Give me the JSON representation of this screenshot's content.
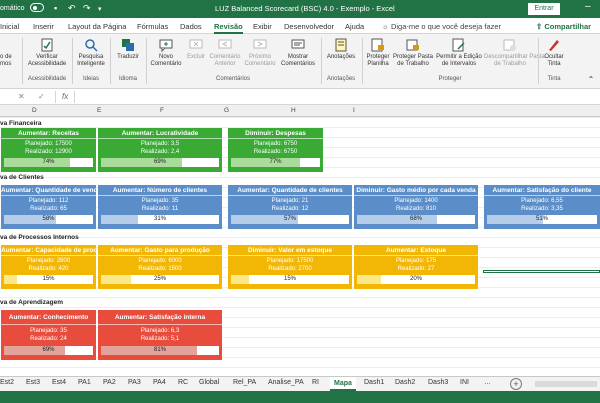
{
  "titlebar": {
    "autosave": "omático",
    "title": "LUZ Balanced Scorecard (BSC) 4.0 - Exemplo  -  Excel",
    "signin": "Entrar"
  },
  "tabs": [
    "Inicial",
    "Inserir",
    "Layout da Página",
    "Fórmulas",
    "Dados",
    "Revisão",
    "Exibir",
    "Desenvolvedor",
    "Ajuda"
  ],
  "tellme": "Diga-me o que você deseja fazer",
  "share": "Compartilhar",
  "ribbon": {
    "buttons": [
      {
        "label": "Verificar\nAcessibilidade",
        "icon": "check-icon",
        "disabled": false
      },
      {
        "label": "Pesquisa\nInteligente",
        "icon": "search-icon",
        "disabled": false
      },
      {
        "label": "Traduzir",
        "icon": "translate-icon",
        "disabled": false
      },
      {
        "label": "Novo\nComentário",
        "icon": "new-comment-icon",
        "disabled": false
      },
      {
        "label": "Excluir",
        "icon": "delete-comment-icon",
        "disabled": true
      },
      {
        "label": "Comentário\nAnterior",
        "icon": "previous-comment-icon",
        "disabled": true
      },
      {
        "label": "Próximo\nComentário",
        "icon": "next-comment-icon",
        "disabled": true
      },
      {
        "label": "Mostrar\nComentários",
        "icon": "show-comments-icon",
        "disabled": false
      },
      {
        "label": "Anotações",
        "icon": "notes-icon",
        "disabled": false
      },
      {
        "label": "Proteger\nPlanilha",
        "icon": "protect-sheet-icon",
        "disabled": false
      },
      {
        "label": "Proteger Pasta\nde Trabalho",
        "icon": "protect-workbook-icon",
        "disabled": false
      },
      {
        "label": "Permitir a Edição\nde Intervalos",
        "icon": "allow-edit-icon",
        "disabled": false
      },
      {
        "label": "Descompartilhar Pasta\nde Trabalho",
        "icon": "unshare-icon",
        "disabled": true
      },
      {
        "label": "Ocultar\nTinta",
        "icon": "ink-icon",
        "disabled": false
      }
    ],
    "groups": [
      "Acessibilidade",
      "Ideias",
      "Idioma",
      "Comentários",
      "Anotações",
      "Proteger",
      "Tinta"
    ],
    "partial_left": "o de\nmos"
  },
  "columns": [
    "D",
    "E",
    "F",
    "G",
    "H",
    "I"
  ],
  "sections": {
    "financeira": "va Financeira",
    "clientes": "va de Clientes",
    "processos": "va de Processos Internos",
    "aprendizagem": "va de Aprendizagem"
  },
  "cards": {
    "fin": [
      {
        "title": "Aumentar: Receitas",
        "planned": "Planejado: 17500",
        "actual": "Realizado: 12900",
        "pct": "74%",
        "progress": 0.74
      },
      {
        "title": "Aumentar: Lucratividade",
        "planned": "Planejado: 3,5",
        "actual": "Realizado: 2,4",
        "pct": "69%",
        "progress": 0.69
      },
      {
        "title": "Diminuir: Despesas",
        "planned": "Planejado: 6750",
        "actual": "Realizado: 6750",
        "pct": "77%",
        "progress": 0.77
      }
    ],
    "cli": [
      {
        "title": "Aumentar: Quantidade de vendas",
        "planned": "Planejado: 112",
        "actual": "Realizado: 65",
        "pct": "58%",
        "progress": 0.58
      },
      {
        "title": "Aumentar: Número de clientes",
        "planned": "Planejado: 35",
        "actual": "Realizado: 11",
        "pct": "31%",
        "progress": 0.31
      },
      {
        "title": "Aumentar: Quantidade de clientes",
        "planned": "Planejado: 21",
        "actual": "Realizado: 12",
        "pct": "57%",
        "progress": 0.57
      },
      {
        "title": "Diminuir: Gasto médio por cada venda",
        "planned": "Planejado: 1400",
        "actual": "Realizado: 810",
        "pct": "68%",
        "progress": 0.68
      },
      {
        "title": "Aumentar: Satisfação do cliente",
        "planned": "Planejado: 6,55",
        "actual": "Realizado: 3,35",
        "pct": "51%",
        "progress": 0.51
      }
    ],
    "proc": [
      {
        "title": "Aumentar: Capacidade de produção",
        "planned": "Planejado: 2800",
        "actual": "Realizado: 420",
        "pct": "15%",
        "progress": 0.15
      },
      {
        "title": "Aumentar: Gasto para produção",
        "planned": "Planejado: 6000",
        "actual": "Realizado: 1500",
        "pct": "25%",
        "progress": 0.25
      },
      {
        "title": "Diminuir: Valor em estoque",
        "planned": "Planejado: 17500",
        "actual": "Realizado: 2700",
        "pct": "15%",
        "progress": 0.15
      },
      {
        "title": "Aumentar: Estoque",
        "planned": "Planejado: 175",
        "actual": "Realizado: 27",
        "pct": "20%",
        "progress": 0.2
      }
    ],
    "apr": [
      {
        "title": "Aumentar: Conhecimento",
        "planned": "Planejado: 35",
        "actual": "Realizado: 24",
        "pct": "69%",
        "progress": 0.69
      },
      {
        "title": "Aumentar: Satisfação interna",
        "planned": "Planejado: 6,3",
        "actual": "Realizado: 5,1",
        "pct": "81%",
        "progress": 0.81
      }
    ]
  },
  "sheets": [
    "Est2",
    "Est3",
    "Est4",
    "PA1",
    "PA2",
    "PA3",
    "PA4",
    "RC",
    "Global",
    "Rel_PA",
    "Analise_PA",
    "RI",
    "Mapa",
    "Dash1",
    "Dash2",
    "Dash3",
    "INI"
  ],
  "active_sheet": "Mapa",
  "colors": {
    "excel_green": "#217346",
    "financeira": "#3aaa35",
    "clientes": "#5b8ec9",
    "processos": "#f2b705",
    "aprendizagem": "#e74c3c"
  }
}
